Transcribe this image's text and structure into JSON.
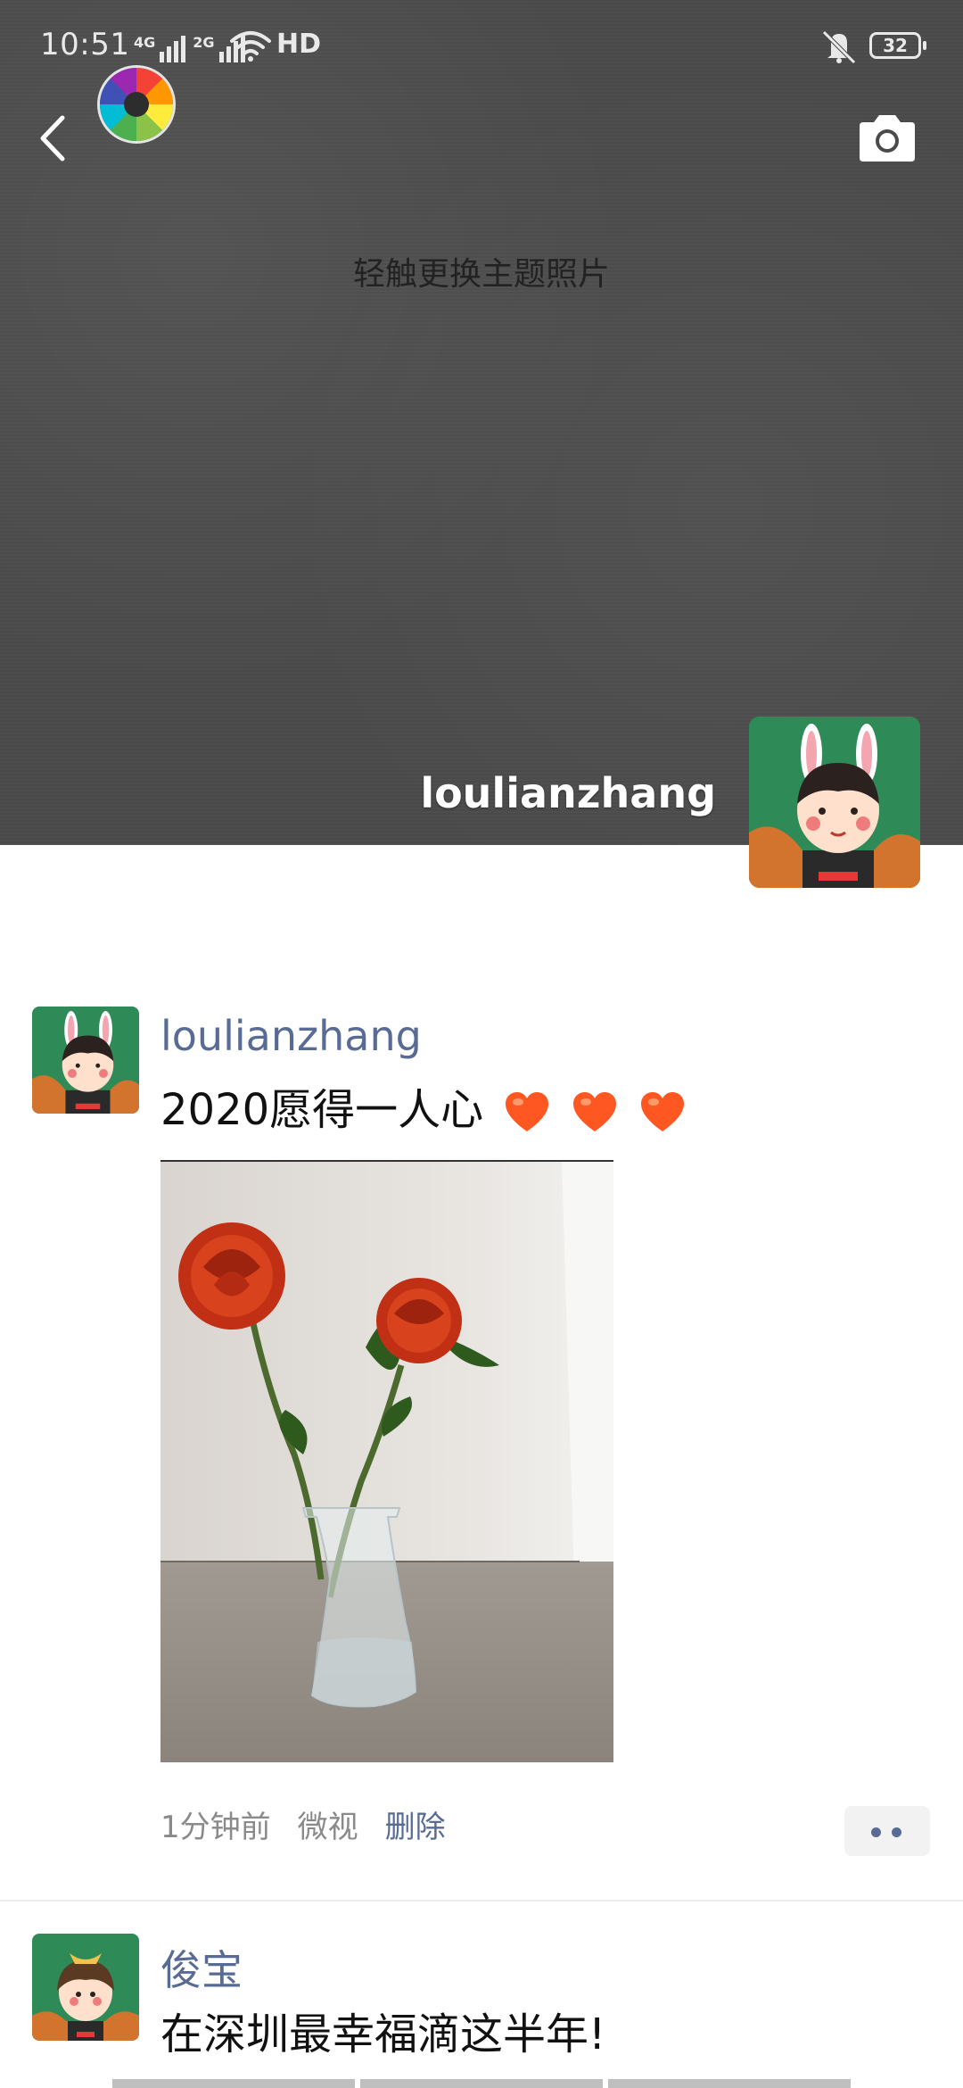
{
  "status_bar": {
    "time": "10:51",
    "network_1": "4G",
    "network_2": "2G",
    "hd_label": "HD",
    "battery": "32"
  },
  "header": {
    "back_icon": "chevron-left-icon",
    "camera_icon": "camera-icon",
    "app_icon": "camera-app-icon",
    "cover_hint": "轻触更换主题照片"
  },
  "profile": {
    "name": "loulianzhang"
  },
  "posts": [
    {
      "author": "loulianzhang",
      "text": "2020愿得一人心",
      "emoji_count": 3,
      "time": "1分钟前",
      "source": "微视",
      "delete_label": "删除"
    },
    {
      "author": "俊宝",
      "text": "在深圳最幸福滴这半年!"
    }
  ],
  "colors": {
    "link_blue": "#576b95",
    "cover_gray": "#4a4a4a",
    "heart": "#ff5722"
  }
}
